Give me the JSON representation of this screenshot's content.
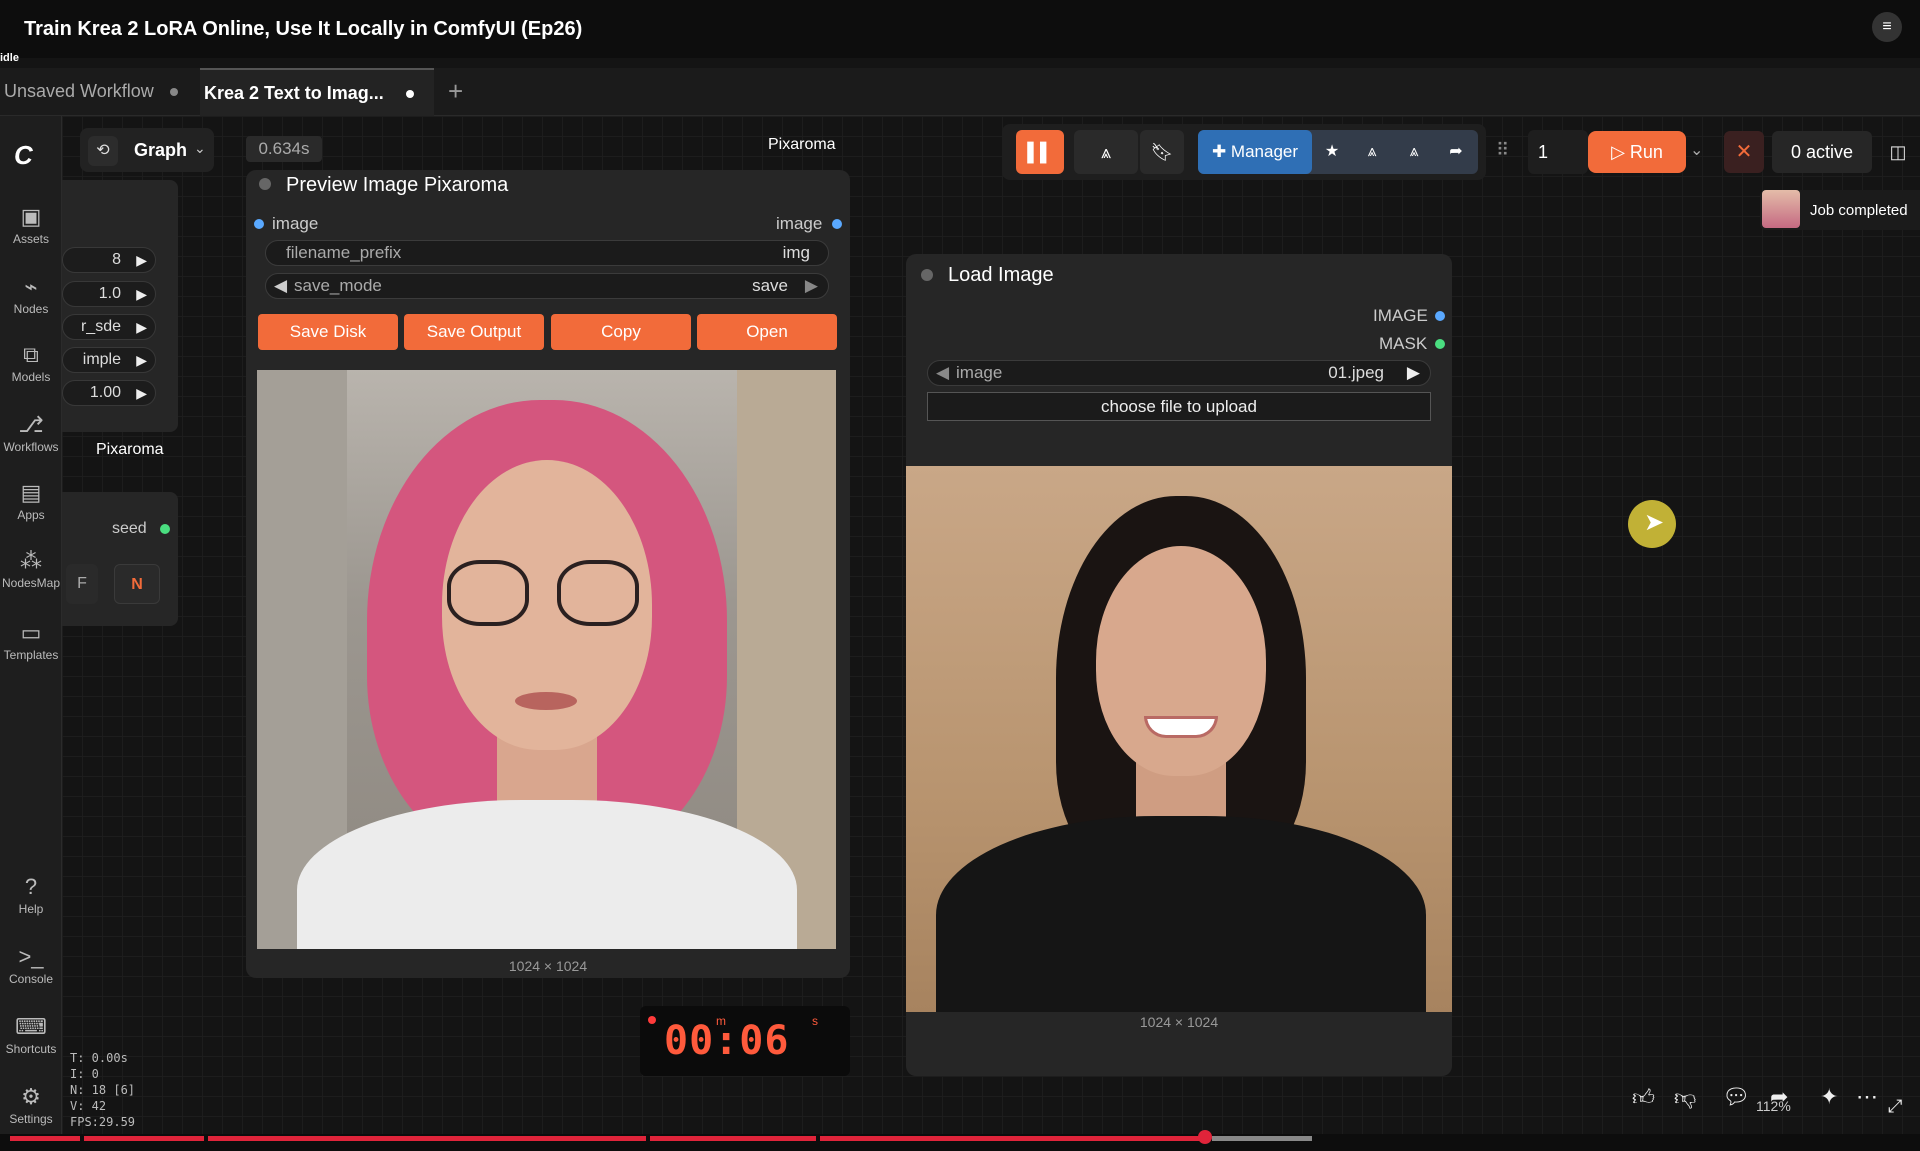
{
  "video_title": "Train Krea 2 LoRA Online, Use It Locally in ComfyUI (Ep26)",
  "status_idle": "idle",
  "tabs": [
    {
      "label": "Unsaved Workflow"
    },
    {
      "label": "Krea 2 Text to Imag..."
    }
  ],
  "sidebar": {
    "items": [
      {
        "label": "Assets",
        "icon": "image-icon"
      },
      {
        "label": "Nodes",
        "icon": "nodes-icon"
      },
      {
        "label": "Models",
        "icon": "models-icon"
      },
      {
        "label": "Workflows",
        "icon": "workflows-icon"
      },
      {
        "label": "Apps",
        "icon": "apps-icon"
      },
      {
        "label": "NodesMap",
        "icon": "nodesmap-icon"
      },
      {
        "label": "Templates",
        "icon": "templates-icon"
      },
      {
        "label": "Help",
        "icon": "help-icon"
      },
      {
        "label": "Console",
        "icon": "console-icon"
      },
      {
        "label": "Shortcuts",
        "icon": "keyboard-icon"
      },
      {
        "label": "Settings",
        "icon": "gear-icon"
      }
    ]
  },
  "graph_menu": {
    "label": "Graph"
  },
  "left_node": {
    "fields": [
      {
        "value": "8"
      },
      {
        "value": "1.0"
      },
      {
        "value": "r_sde"
      },
      {
        "value": "imple"
      },
      {
        "value": "1.00"
      }
    ],
    "pixaroma_label": "Pixaroma",
    "seed_label": "seed",
    "btn_f": "F",
    "btn_n": "N"
  },
  "timing_badge": "0.634s",
  "pixaroma_top_label": "Pixaroma",
  "preview_node": {
    "title": "Preview Image Pixaroma",
    "input_label": "image",
    "output_label": "image",
    "filename_prefix_label": "filename_prefix",
    "filename_prefix_value": "img",
    "save_mode_label": "save_mode",
    "save_mode_value": "save",
    "buttons": [
      "Save Disk",
      "Save Output",
      "Copy",
      "Open"
    ],
    "dims": "1024 × 1024"
  },
  "load_node": {
    "title": "Load Image",
    "output_image": "IMAGE",
    "output_mask": "MASK",
    "image_label": "image",
    "image_value": "01.jpeg",
    "upload_label": "choose file to upload",
    "dims": "1024 × 1024"
  },
  "toolbar": {
    "manager_label": "Manager",
    "run_count": "1",
    "run_label": "Run",
    "active_label": "0 active"
  },
  "job_status": "Job completed",
  "timer": {
    "display": "00:06",
    "m": "m",
    "s": "s"
  },
  "stats": {
    "t": "T: 0.00s",
    "i": "I: 0",
    "n": "N: 18 [6]",
    "v": "V: 42",
    "fps": "FPS:29.59"
  },
  "zoom_level": "112%",
  "colors": {
    "accent": "#f26b3a",
    "manager_blue": "#2f6fb5",
    "progress_red": "#e0243a",
    "slot_blue": "#5aa9ff",
    "slot_green": "#4ade80"
  },
  "video_progress": 0.63
}
